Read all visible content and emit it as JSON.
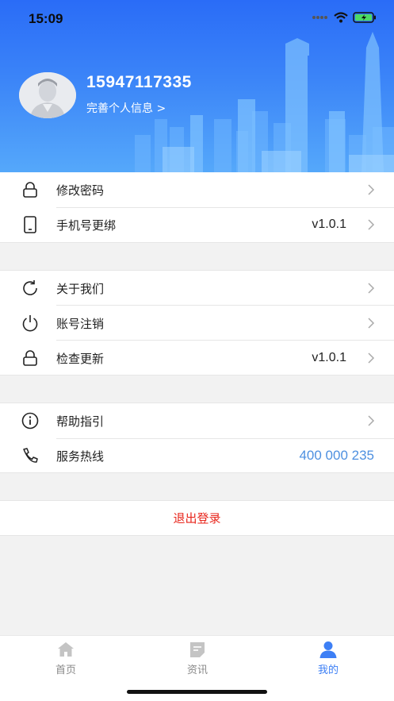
{
  "status_bar": {
    "time": "15:09",
    "icons": [
      "signal-icon",
      "wifi-icon",
      "battery-charging-icon"
    ]
  },
  "profile": {
    "phone": "15947117335",
    "complete_info": "完善个人信息 >",
    "avatar_icon": "user-avatar-icon"
  },
  "group1": {
    "items": [
      {
        "label": "修改密码",
        "icon": "lock-icon",
        "value": ""
      },
      {
        "label": "手机号更绑",
        "icon": "phone-icon",
        "value": "v1.0.1"
      }
    ]
  },
  "group2": {
    "items": [
      {
        "label": "关于我们",
        "icon": "refresh-icon",
        "value": ""
      },
      {
        "label": "账号注销",
        "icon": "power-icon",
        "value": ""
      },
      {
        "label": "检查更新",
        "icon": "lock-icon",
        "value": "v1.0.1"
      }
    ]
  },
  "group3": {
    "items": [
      {
        "label": "帮助指引",
        "icon": "info-icon",
        "value": ""
      },
      {
        "label": "服务热线",
        "icon": "telephone-icon",
        "value": "400 000 235"
      }
    ]
  },
  "logout": {
    "label": "退出登录"
  },
  "tabbar": {
    "tabs": [
      {
        "label": "首页",
        "icon": "home-icon",
        "active": false
      },
      {
        "label": "资讯",
        "icon": "news-icon",
        "active": false
      },
      {
        "label": "我的",
        "icon": "user-icon",
        "active": true
      }
    ]
  },
  "colors": {
    "header_gradient_top": "#2a6cf7",
    "header_gradient_bottom": "#55a8fa",
    "accent": "#3d7ff5",
    "hotline": "#4e90e0",
    "logout": "#e8261c"
  }
}
